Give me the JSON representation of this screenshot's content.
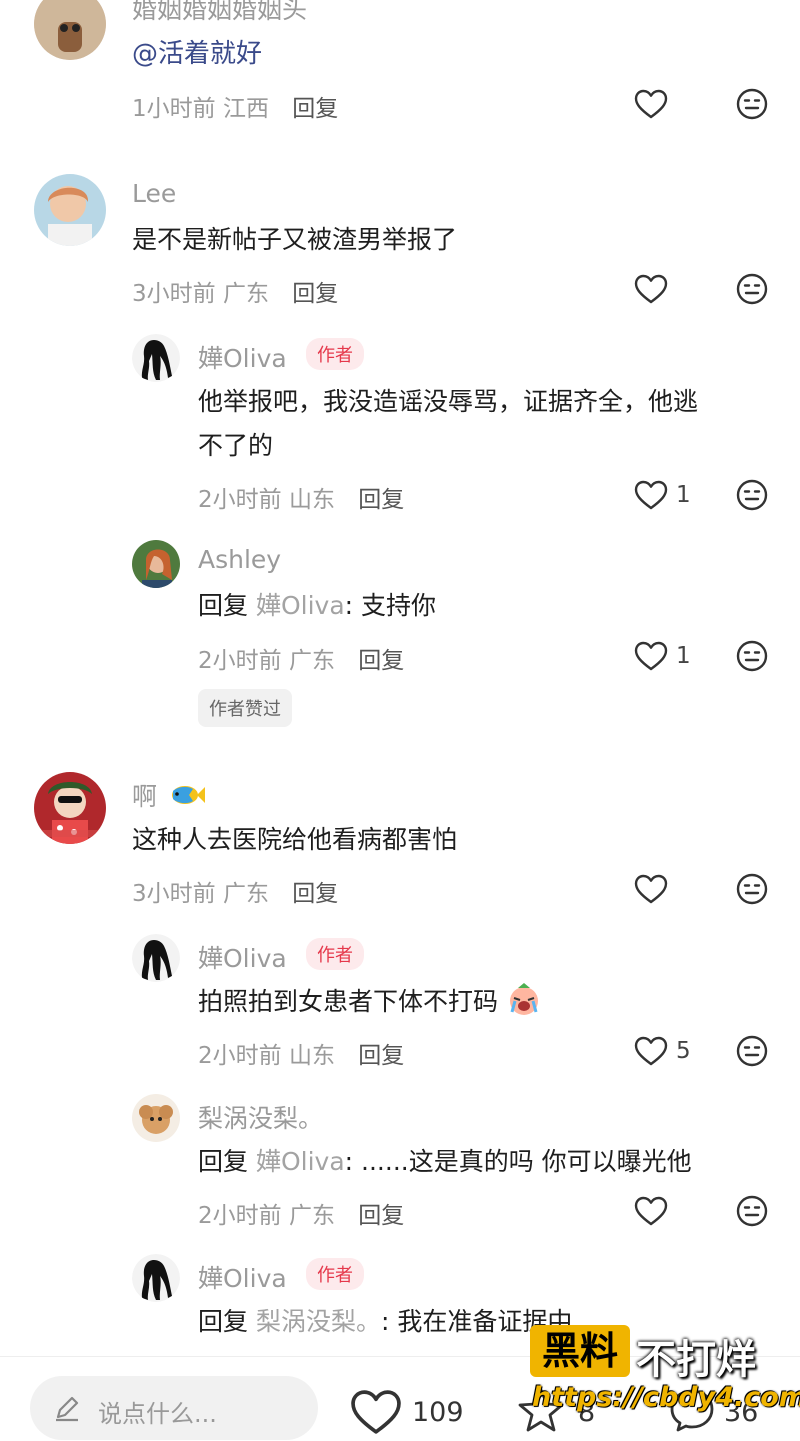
{
  "comments": [
    {
      "cut_text": "婚姻婚姻婚姻头",
      "text": "@活着就好",
      "time": "1小时前",
      "loc": "江西",
      "reply": "回复"
    },
    {
      "name": "Lee",
      "text": "是不是新帖子又被渣男举报了",
      "time": "3小时前",
      "loc": "广东",
      "reply": "回复"
    },
    {
      "name": "嬅Oliva",
      "badge": "作者",
      "text1": "他举报吧，我没造谣没辱骂，证据齐全，他逃",
      "text2": "不了的",
      "time": "2小时前",
      "loc": "山东",
      "reply": "回复",
      "likes": "1"
    },
    {
      "name": "Ashley",
      "prefix": "回复",
      "target": "嬅Oliva",
      "text": ": 支持你",
      "time": "2小时前",
      "loc": "广东",
      "reply": "回复",
      "likes": "1",
      "tag": "作者赞过"
    },
    {
      "name": "啊",
      "text": "这种人去医院给他看病都害怕",
      "time": "3小时前",
      "loc": "广东",
      "reply": "回复"
    },
    {
      "name": "嬅Oliva",
      "badge": "作者",
      "text": "拍照拍到女患者下体不打码",
      "time": "2小时前",
      "loc": "山东",
      "reply": "回复",
      "likes": "5"
    },
    {
      "name": "梨涡没梨。",
      "prefix": "回复",
      "target": "嬅Oliva",
      "text": ": ......这是真的吗 你可以曝光他",
      "time": "2小时前",
      "loc": "广东",
      "reply": "回复"
    },
    {
      "name": "嬅Oliva",
      "badge": "作者",
      "prefix": "回复",
      "target": "梨涡没梨。",
      "text": ": 我在准备证据中..."
    }
  ],
  "bottom": {
    "placeholder": "说点什么...",
    "likes": "109",
    "stars": "8",
    "comments": "36"
  },
  "watermark": {
    "box": "黑料",
    "rest": "不打烊",
    "url": "https://cbdy4.com"
  },
  "colors": {
    "author_badge": "#e5384b",
    "watermark": "#f0b400"
  }
}
